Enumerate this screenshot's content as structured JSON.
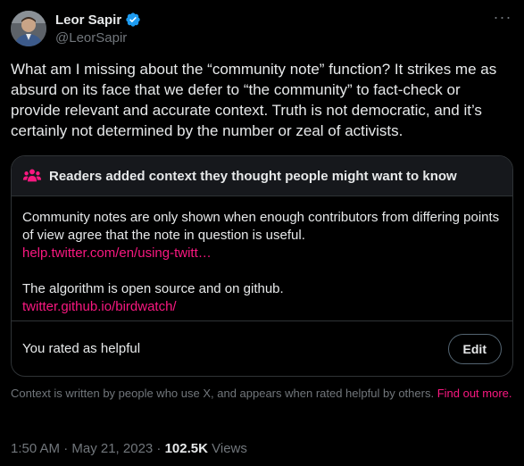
{
  "tweet": {
    "author": {
      "display_name": "Leor Sapir",
      "handle": "@LeorSapir",
      "avatar_icon": "user-avatar",
      "verified_icon": "verified-badge-icon"
    },
    "more_icon": "more-horizontal-icon",
    "text": "What am I missing about the “community note” function? It strikes me as absurd on its face that we defer to “the community” to fact-check or provide relevant and accurate context. Truth is not democratic, and it’s certainly not determined by the number or zeal of activists.",
    "timestamp": "1:50 AM · May 21, 2023 · ",
    "views_count": "102.5K",
    "views_label": " Views"
  },
  "community_note": {
    "header_icon": "people-icon",
    "header": "Readers added context they thought people might want to know",
    "paragraph1": "Community notes are only shown when enough contributors from differing points of view agree that the note in question is useful.",
    "link1": "help.twitter.com/en/using-twitt…",
    "paragraph2": "The algorithm is open source and on github.",
    "link2": "twitter.github.io/birdwatch/",
    "rated_label": "You rated as helpful",
    "edit_label": "Edit",
    "disclaimer": "Context is written by people who use X, and appears when rated helpful by others.  ",
    "find_out_more": "Find out more."
  },
  "colors": {
    "background": "#000000",
    "text": "#e7e9ea",
    "secondary": "#71767b",
    "accent_pink": "#f91880",
    "verified_blue": "#1d9bf0",
    "border": "#2f3336"
  }
}
